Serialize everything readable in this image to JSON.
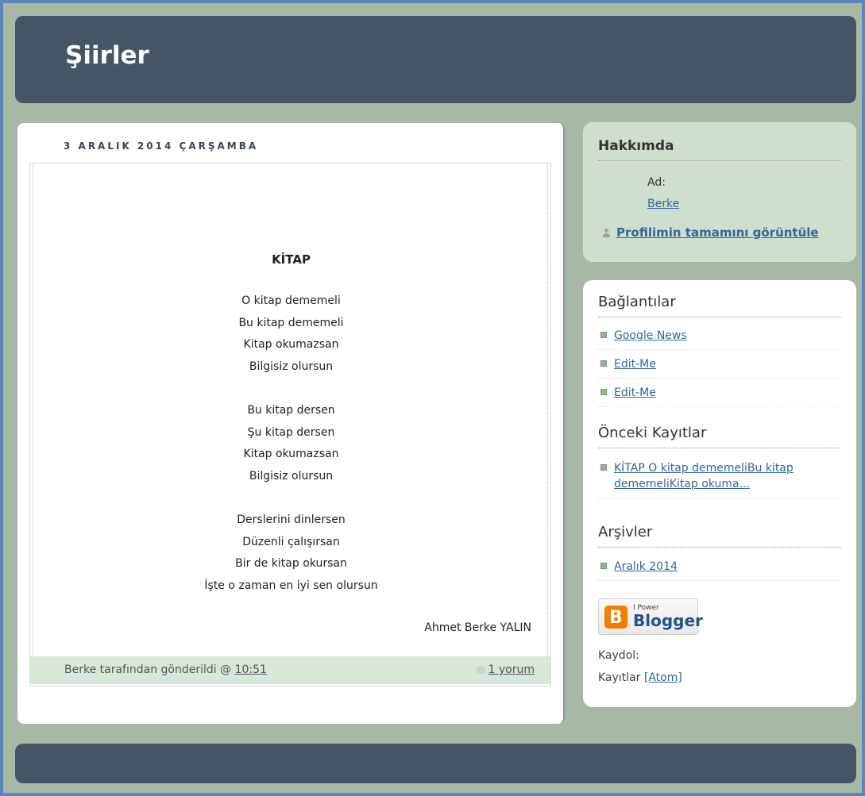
{
  "header": {
    "title": "Şiirler"
  },
  "post": {
    "date": "3 ARALIK 2014 ÇARŞAMBA",
    "title": "KİTAP",
    "stanzas": [
      [
        "O kitap dememeli",
        "Bu kitap dememeli",
        "Kitap okumazsan",
        "Bilgisiz olursun"
      ],
      [
        "Bu kitap dersen",
        "Şu kitap dersen",
        "Kitap okumazsan",
        "Bilgisiz olursun"
      ],
      [
        "Derslerini dinlersen",
        "Düzenli çalışırsan",
        "Bir de kitap okursan",
        "İşte o zaman en iyi sen olursun"
      ]
    ],
    "author": "Ahmet Berke YALIN",
    "footer": {
      "posted_by": "Berke tarafından gönderildi @",
      "time": "10:51",
      "comments": "1 yorum"
    }
  },
  "sidebar": {
    "about": {
      "title": "Hakkımda",
      "name_label": "Ad:",
      "name": "Berke",
      "profile_link": "Profilimin tamamını görüntüle"
    },
    "links": {
      "title": "Bağlantılar",
      "items": [
        {
          "label": "Google News"
        },
        {
          "label": "Edit-Me"
        },
        {
          "label": "Edit-Me"
        }
      ]
    },
    "previous": {
      "title": "Önceki Kayıtlar",
      "items": [
        {
          "label": "KİTAP O kitap dememeliBu kitap dememeliKitap okuma..."
        }
      ]
    },
    "archives": {
      "title": "Arşivler",
      "items": [
        {
          "label": "Aralık 2014"
        }
      ]
    },
    "badge": {
      "small": "I Power",
      "big": "Blogger"
    },
    "subscribe_label": "Kaydol:",
    "feed_label": "Kayıtlar",
    "feed_link": "[Atom]"
  },
  "colors": {
    "background": "#a7b8a5",
    "header": "#465565",
    "link": "#336699",
    "about_box": "#cfdecf",
    "post_footer": "#d9e7d8"
  }
}
